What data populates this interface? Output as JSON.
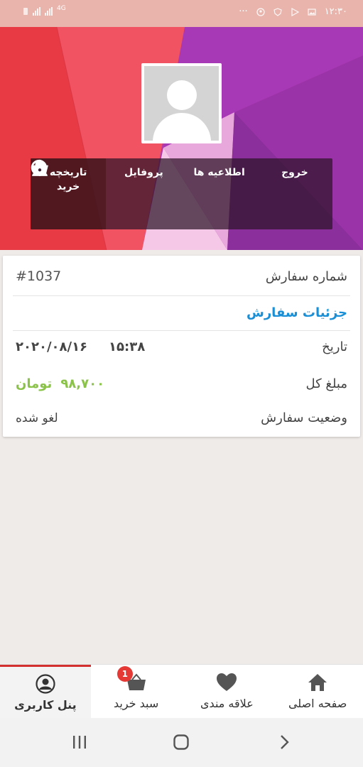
{
  "status_bar": {
    "time": "۱۲:۳۰",
    "network": "4G",
    "dots": "···"
  },
  "header": {
    "actions": [
      {
        "label": "خروج",
        "icon": "logout-icon"
      },
      {
        "label": "اطلاعیه ها",
        "icon": "bell-icon"
      },
      {
        "label": "پروفایل",
        "icon": "user-icon"
      },
      {
        "label": "تاریخچه\nخرید",
        "icon": "basket-icon"
      }
    ]
  },
  "order": {
    "number_label": "شماره سفارش",
    "number_value": "#1037",
    "details_link": "جزئیات سفارش",
    "date_label": "تاریخ",
    "time_value": "۱۵:۳۸",
    "date_value": "۲۰۲۰/۰۸/۱۶",
    "total_label": "مبلغ کل",
    "total_amount": "۹۸,۷۰۰",
    "total_currency": "تومان",
    "status_label": "وضعیت سفارش",
    "status_value": "لغو شده"
  },
  "bottom_nav": {
    "items": [
      {
        "label": "صفحه اصلی",
        "icon": "home-icon"
      },
      {
        "label": "علاقه مندی",
        "icon": "heart-icon"
      },
      {
        "label": "سبد خرید",
        "icon": "cart-icon",
        "badge": "1"
      },
      {
        "label": "پنل کاربری",
        "icon": "account-icon",
        "active": true
      }
    ]
  },
  "colors": {
    "accent": "#d32f2f",
    "link": "#1a8fd6",
    "price": "#8bc34a",
    "status_bar": "#e8b4ac"
  }
}
